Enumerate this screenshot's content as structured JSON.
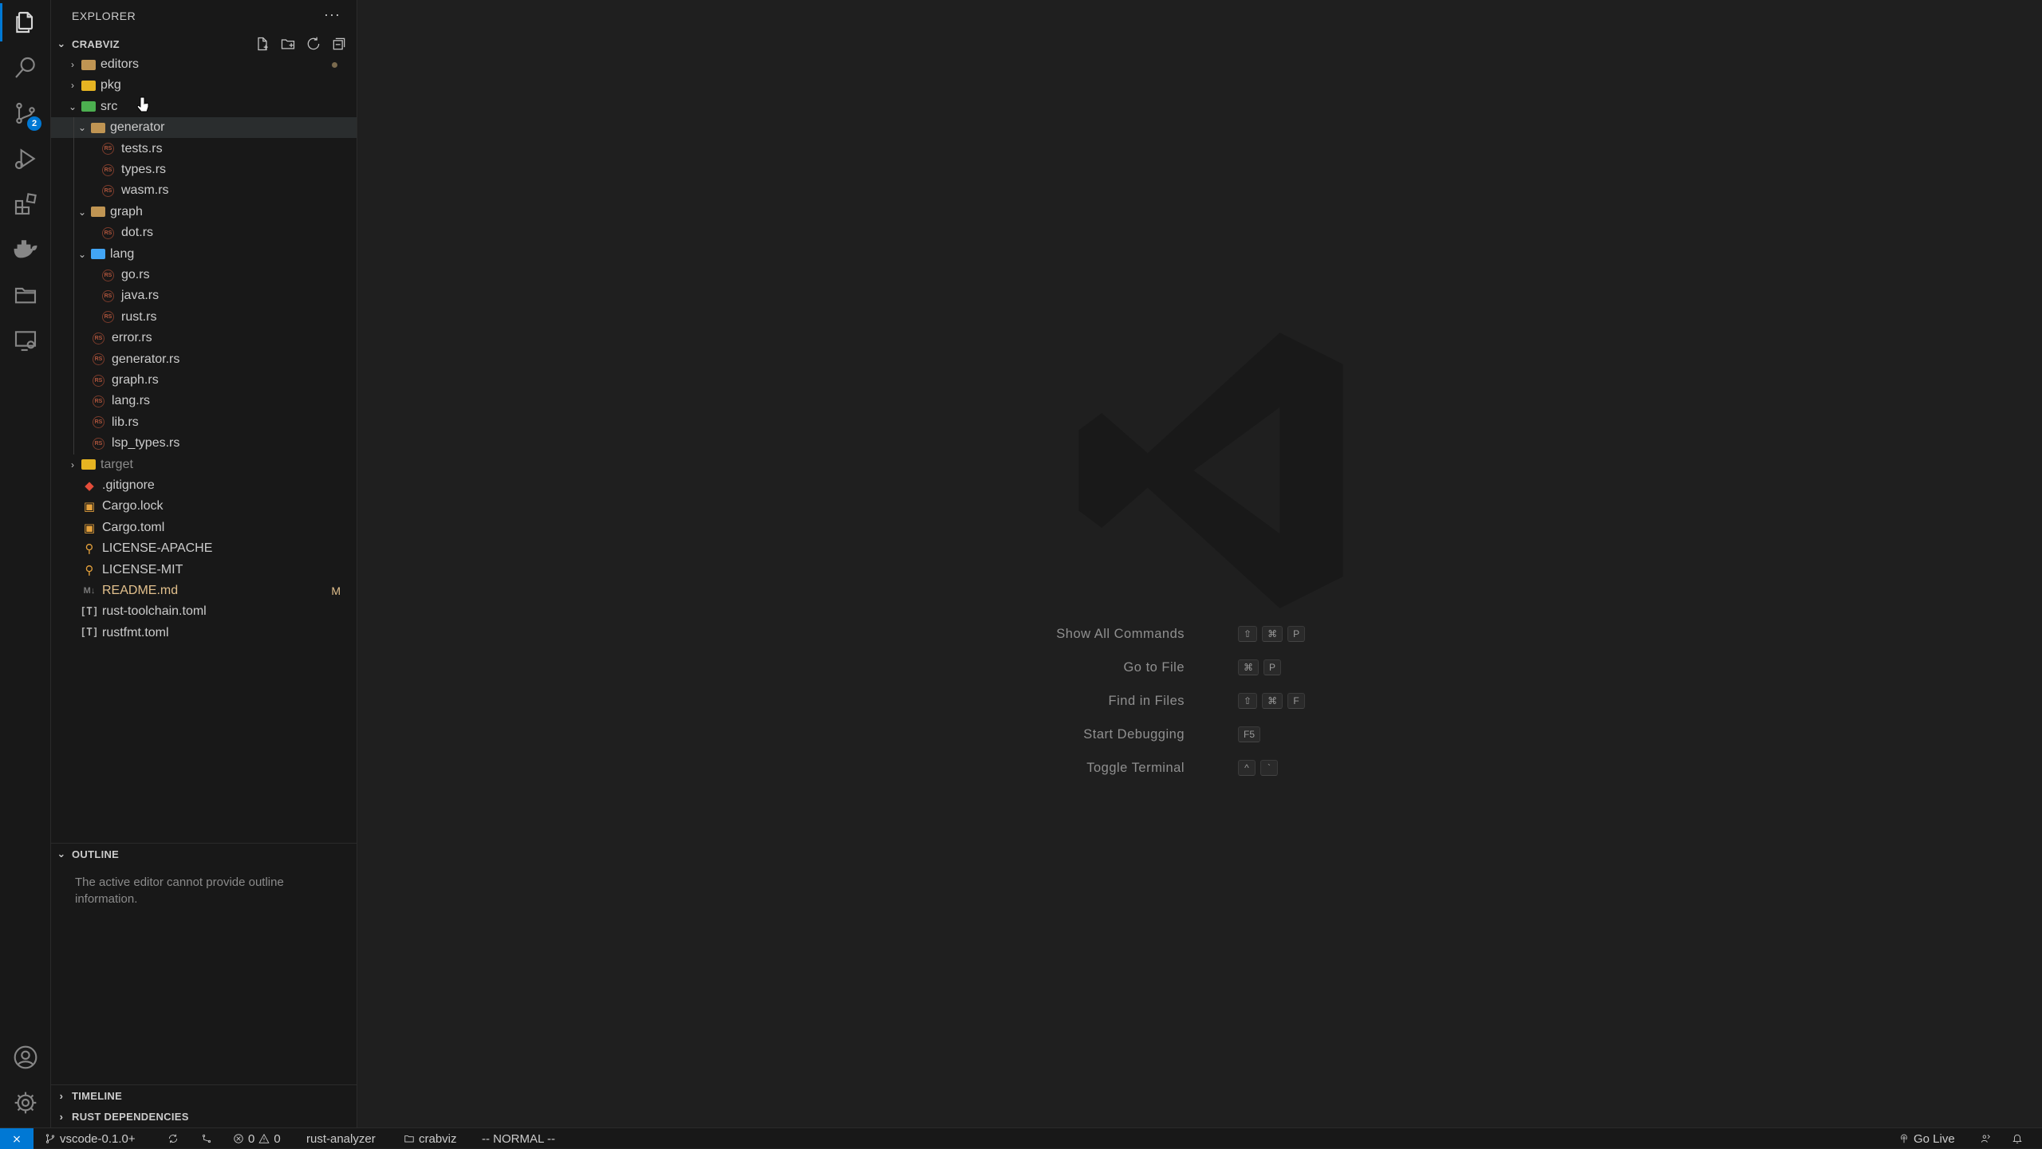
{
  "activity_bar": {
    "items": [
      {
        "name": "explorer-icon"
      },
      {
        "name": "search-icon"
      },
      {
        "name": "source-control-icon",
        "badge": "2"
      },
      {
        "name": "run-debug-icon"
      },
      {
        "name": "extensions-icon"
      },
      {
        "name": "docker-icon"
      },
      {
        "name": "project-manager-icon"
      },
      {
        "name": "remote-explorer-icon"
      }
    ],
    "bottom": [
      {
        "name": "account-icon"
      },
      {
        "name": "manage-gear-icon"
      }
    ]
  },
  "sidebar": {
    "title": "EXPLORER",
    "more": "···",
    "project": "CRABVIZ",
    "tree": [
      {
        "label": "editors",
        "type": "folder",
        "color": "#c09553",
        "depth": 0,
        "expanded": false,
        "dot": true
      },
      {
        "label": "pkg",
        "type": "folder",
        "color": "#e6b422",
        "depth": 0,
        "expanded": false
      },
      {
        "label": "src",
        "type": "folder",
        "color": "#4caf50",
        "depth": 0,
        "expanded": true
      },
      {
        "label": "generator",
        "type": "folder",
        "color": "#c09553",
        "depth": 1,
        "expanded": true,
        "selected": true
      },
      {
        "label": "tests.rs",
        "type": "rs",
        "depth": 2
      },
      {
        "label": "types.rs",
        "type": "rs",
        "depth": 2
      },
      {
        "label": "wasm.rs",
        "type": "rs",
        "depth": 2
      },
      {
        "label": "graph",
        "type": "folder",
        "color": "#c09553",
        "depth": 1,
        "expanded": true
      },
      {
        "label": "dot.rs",
        "type": "rs",
        "depth": 2
      },
      {
        "label": "lang",
        "type": "folder",
        "color": "#42a5f5",
        "depth": 1,
        "expanded": true
      },
      {
        "label": "go.rs",
        "type": "rs",
        "depth": 2
      },
      {
        "label": "java.rs",
        "type": "rs",
        "depth": 2
      },
      {
        "label": "rust.rs",
        "type": "rs",
        "depth": 2
      },
      {
        "label": "error.rs",
        "type": "rs",
        "depth": 1
      },
      {
        "label": "generator.rs",
        "type": "rs",
        "depth": 1
      },
      {
        "label": "graph.rs",
        "type": "rs",
        "depth": 1
      },
      {
        "label": "lang.rs",
        "type": "rs",
        "depth": 1
      },
      {
        "label": "lib.rs",
        "type": "rs",
        "depth": 1
      },
      {
        "label": "lsp_types.rs",
        "type": "rs",
        "depth": 1
      },
      {
        "label": "target",
        "type": "folder",
        "color": "#e6b422",
        "depth": 0,
        "expanded": false,
        "dim": true
      },
      {
        "label": ".gitignore",
        "type": "git",
        "depth": 0
      },
      {
        "label": "Cargo.lock",
        "type": "cargo",
        "depth": 0
      },
      {
        "label": "Cargo.toml",
        "type": "cargo",
        "depth": 0
      },
      {
        "label": "LICENSE-APACHE",
        "type": "lic",
        "depth": 0
      },
      {
        "label": "LICENSE-MIT",
        "type": "lic",
        "depth": 0
      },
      {
        "label": "README.md",
        "type": "md",
        "depth": 0,
        "modified": true,
        "deco": "M"
      },
      {
        "label": "rust-toolchain.toml",
        "type": "toml",
        "depth": 0
      },
      {
        "label": "rustfmt.toml",
        "type": "toml",
        "depth": 0
      }
    ],
    "outline": {
      "title": "OUTLINE",
      "message": "The active editor cannot provide outline information."
    },
    "timeline": "TIMELINE",
    "rust_deps": "RUST DEPENDENCIES"
  },
  "editor": {
    "shortcuts": [
      {
        "label": "Show All Commands",
        "keys": [
          "⇧",
          "⌘",
          "P"
        ]
      },
      {
        "label": "Go to File",
        "keys": [
          "⌘",
          "P"
        ]
      },
      {
        "label": "Find in Files",
        "keys": [
          "⇧",
          "⌘",
          "F"
        ]
      },
      {
        "label": "Start Debugging",
        "keys": [
          "F5"
        ]
      },
      {
        "label": "Toggle Terminal",
        "keys": [
          "^",
          "`"
        ]
      }
    ]
  },
  "statusbar": {
    "branch": "vscode-0.1.0+",
    "errors": "0",
    "warnings": "0",
    "rust_analyzer": "rust-analyzer",
    "folder": "crabviz",
    "mode": "-- NORMAL --",
    "go_live": "Go Live"
  }
}
